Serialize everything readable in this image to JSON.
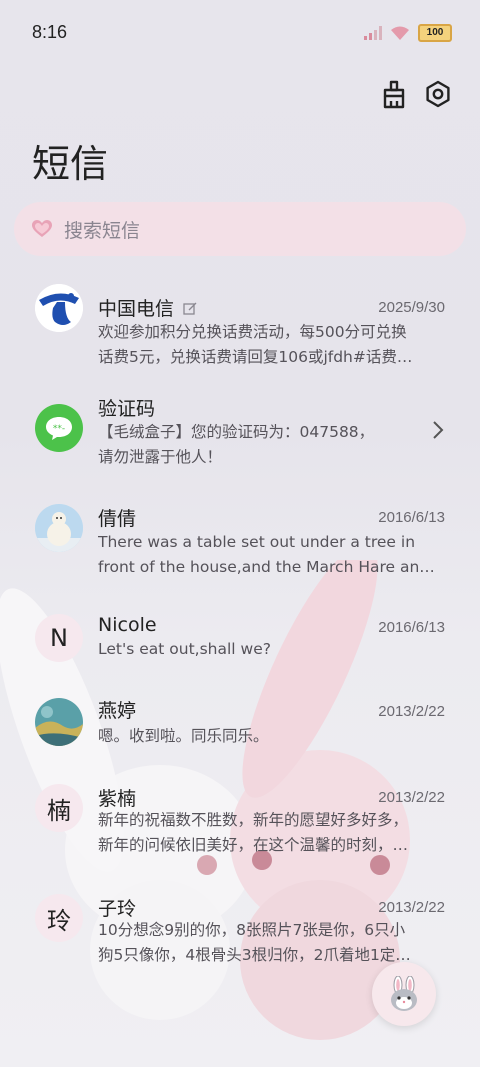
{
  "status": {
    "time": "8:16",
    "battery": "100"
  },
  "toolbar": {
    "clean_icon": "broom-icon",
    "settings_icon": "gear-icon"
  },
  "page": {
    "title": "短信"
  },
  "search": {
    "placeholder": "搜索短信",
    "icon": "heart-icon"
  },
  "conversations": [
    {
      "name": "中国电信",
      "date": "2025/9/30",
      "lines": [
        "欢迎参加积分兑换话费活动，每500分可兑换",
        "话费5元，兑换话费请回复106或jfdh#话费…"
      ]
    },
    {
      "name": "验证码",
      "date": "",
      "lines": [
        "【毛绒盒子】您的验证码为：047588，",
        "请勿泄露于他人！"
      ]
    },
    {
      "name": "倩倩",
      "date": "2016/6/13",
      "lines": [
        "There was a table set out under a tree in",
        "front of the house,and the March Hare an…"
      ]
    },
    {
      "name": "Nicole",
      "date": "2016/6/13",
      "avatar_letter": "N",
      "lines": [
        "Let's eat out,shall we?"
      ]
    },
    {
      "name": "燕婷",
      "date": "2013/2/22",
      "lines": [
        "嗯。收到啦。同乐同乐。"
      ]
    },
    {
      "name": "紫楠",
      "date": "2013/2/22",
      "avatar_letter": "楠",
      "lines": [
        "新年的祝福数不胜数，新年的愿望好多好多，",
        "新年的问候依旧美好，在这个温馨的时刻，…"
      ]
    },
    {
      "name": "子玲",
      "date": "2013/2/22",
      "avatar_letter": "玲",
      "lines": [
        "10分想念9别的你，8张照片7张是你，6只小",
        "狗5只像你，4根骨头3根归你，2爪着地1定…"
      ]
    }
  ],
  "fab": {
    "icon": "bunny-icon"
  },
  "colors": {
    "search_bg": "#f3e0e7",
    "accent_green": "#4cc24a",
    "telecom_blue": "#1f4fb0"
  }
}
